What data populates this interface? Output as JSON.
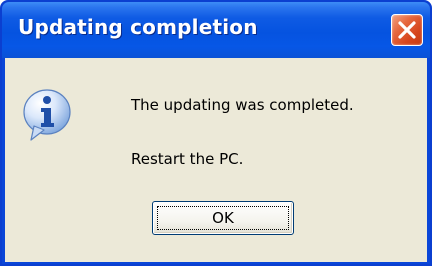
{
  "window": {
    "title": "Updating completion"
  },
  "icons": {
    "title_close": "close-icon",
    "message": "info-icon"
  },
  "message": {
    "line1": "The updating was completed.",
    "line2": "Restart the PC."
  },
  "buttons": {
    "ok_label": "OK"
  },
  "colors": {
    "titlebar": "#0553e0",
    "client_background": "#ece9d8",
    "close_button": "#d6451c"
  }
}
